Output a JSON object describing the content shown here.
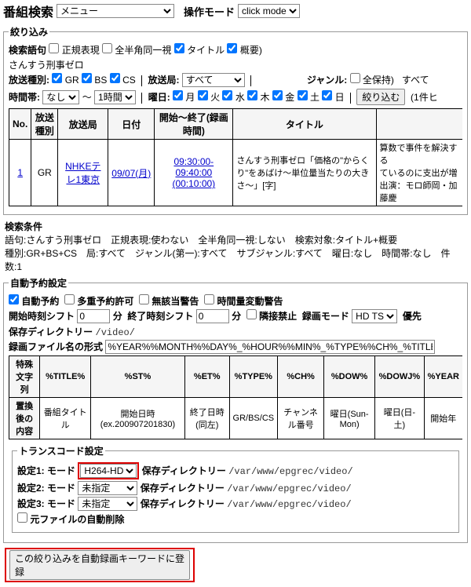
{
  "header": {
    "title": "番組検索",
    "menu_selected": "メニュー",
    "op_mode_label": "操作モード",
    "op_mode_selected": "click mode"
  },
  "filter": {
    "legend": "絞り込み",
    "phrase_label": "検索語句",
    "regex_label": "正規表現",
    "fullwidth_label": "全半角同一視",
    "title_label": "タイトル",
    "summary_label": "概要)",
    "query_text": "さんすう刑事ゼロ",
    "broadcast_label": "放送種別:",
    "gr": "GR",
    "bs": "BS",
    "cs": "CS",
    "station_label": "放送局:",
    "station_selected": "すべて",
    "genre_label": "ジャンル:",
    "allkeep_label": "全保持)",
    "all_label": "すべて",
    "timezone_label": "時間帯:",
    "timezone_from": "なし",
    "tilde": "～",
    "duration": "1時間",
    "weekday_label": "曜日:",
    "days": {
      "mon": "月",
      "tue": "火",
      "wed": "水",
      "thu": "木",
      "fri": "金",
      "sat": "土",
      "sun": "日"
    },
    "submit_label": "絞り込む",
    "hits_suffix": "(1件ヒ"
  },
  "table": {
    "headers": {
      "no": "No.",
      "kind": "放送種別",
      "station": "放送局",
      "date": "日付",
      "time": "開始～終了(録画時間)",
      "title": "タイトル"
    },
    "row": {
      "no": "1",
      "kind": "GR",
      "station": "NHKEテレ1東京",
      "date": "09/07(月)",
      "time1": "09:30:00-09:40:00",
      "time2": "(00:10:00)",
      "title": "さんすう刑事ゼロ「価格の\"からくり\"をあばけ〜単位量当たりの大きさ〜」[字]",
      "extra": "算数で事件を解決する\nているのに支出が増\n出演：モロ師岡・加藤慶"
    }
  },
  "conditions": {
    "label": "検索条件",
    "line1": "語句:さんすう刑事ゼロ　正規表現:使わない　全半角同一視:しない　検索対象:タイトル+概要",
    "line2": "種別:GR+BS+CS　局:すべて　ジャンル(第一):すべて　サブジャンル:すべて　曜日:なし　時間帯:なし　件数:1"
  },
  "auto": {
    "legend": "自動予約設定",
    "autorec": "自動予約",
    "overlap": "多重予約許可",
    "nowarn": "無該当警告",
    "varlen": "時間量変動警告",
    "start_shift": "開始時刻シフト",
    "end_shift": "終了時刻シフト",
    "shift_val0": "0",
    "unit_min": "分",
    "adj_label": "隣接禁止",
    "recmode_label": "録画モード",
    "recmode_selected": "HD TS",
    "prio_label": "優先",
    "savedir_label": "保存ディレクトリー",
    "savedir_value": "/video/",
    "fname_label": "録画ファイル名の形式",
    "fname_value": "%YEAR%%MONTH%%DAY%_%HOUR%%MIN%_%TYPE%%CH%_%TITLE%",
    "fmt_hdr": {
      "sp": "特殊文字列",
      "c1": "%TITLE%",
      "c2": "%ST%",
      "c3": "%ET%",
      "c4": "%TYPE%",
      "c5": "%CH%",
      "c6": "%DOW%",
      "c7": "%DOWJ%",
      "c8": "%YEAR"
    },
    "fmt_row": {
      "sp": "置換後の内容",
      "c1": "番組タイトル",
      "c2": "開始日時(ex.200907201830)",
      "c3": "終了日時(同左)",
      "c4": "GR/BS/CS",
      "c5": "チャンネル番号",
      "c6": "曜日(Sun-Mon)",
      "c7": "曜日(日-土)",
      "c8": "開始年"
    }
  },
  "trans": {
    "legend": "トランスコード設定",
    "row_prefix": [
      "設定1: モード",
      "設定2: モード",
      "設定3: モード"
    ],
    "mode1": "H264-HD",
    "unset": "未指定",
    "dir_label": "保存ディレクトリー",
    "dir_value": "/var/www/epgrec/video/",
    "del_label": "元ファイルの自動削除"
  },
  "register": {
    "label": "この絞り込みを自動録画キーワードに登録"
  }
}
